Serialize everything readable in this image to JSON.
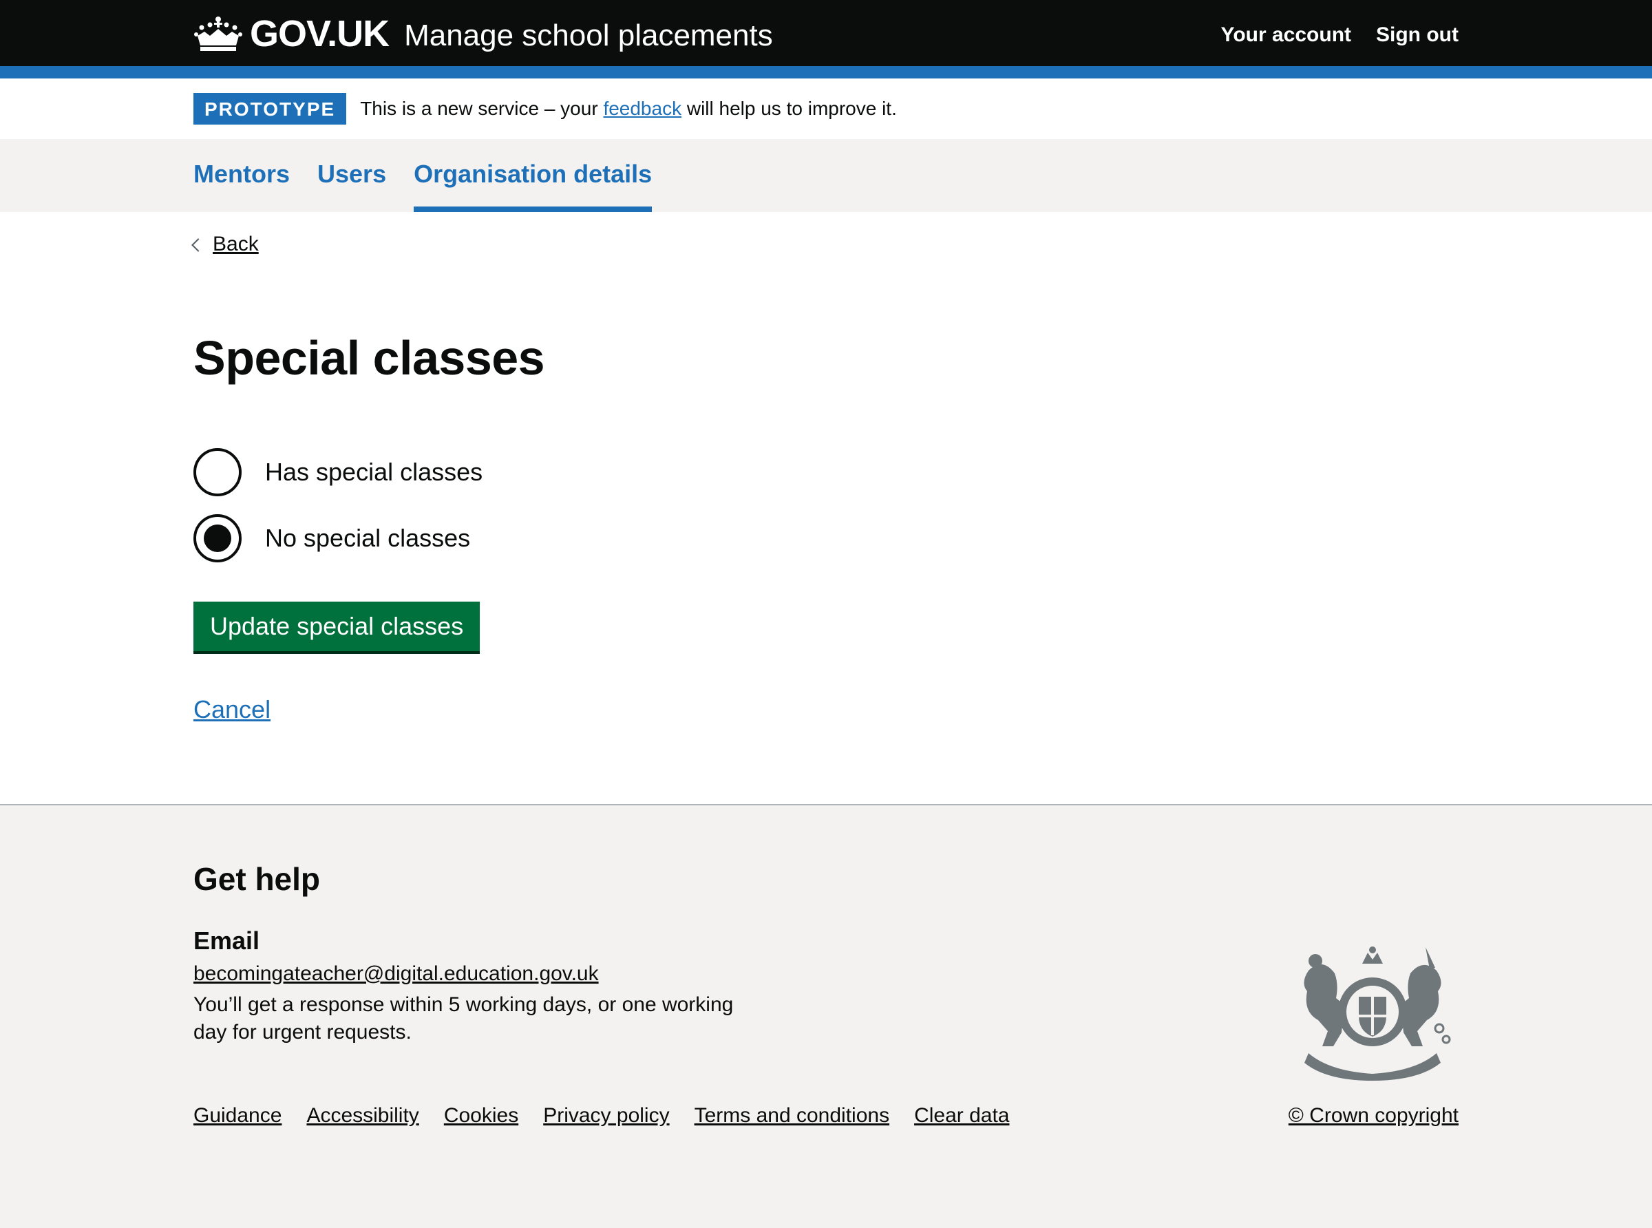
{
  "header": {
    "logo_text": "GOV.UK",
    "service_name": "Manage school placements",
    "nav": [
      "Your account",
      "Sign out"
    ]
  },
  "phase_banner": {
    "tag": "PROTOTYPE",
    "text_before": "This is a new service – your ",
    "link": "feedback",
    "text_after": " will help us to improve it."
  },
  "primary_nav": {
    "items": [
      "Mentors",
      "Users",
      "Organisation details"
    ],
    "current": "Organisation details"
  },
  "main": {
    "back_label": "Back",
    "title": "Special classes",
    "options": [
      {
        "label": "Has special classes",
        "selected": false
      },
      {
        "label": "No special classes",
        "selected": true
      }
    ],
    "submit_label": "Update special classes",
    "cancel_label": "Cancel"
  },
  "footer": {
    "heading": "Get help",
    "email_heading": "Email",
    "email": "becomingateacher@digital.education.gov.uk",
    "response_text": "You’ll get a response within 5 working days, or one working day for urgent requests.",
    "links": [
      "Guidance",
      "Accessibility",
      "Cookies",
      "Privacy policy",
      "Terms and conditions",
      "Clear data"
    ],
    "copyright": "© Crown copyright"
  },
  "colors": {
    "header_bg": "#0b0c0c",
    "brand_blue": "#1d70b8",
    "button_green": "#00703c",
    "footer_bg": "#f3f2f1"
  }
}
